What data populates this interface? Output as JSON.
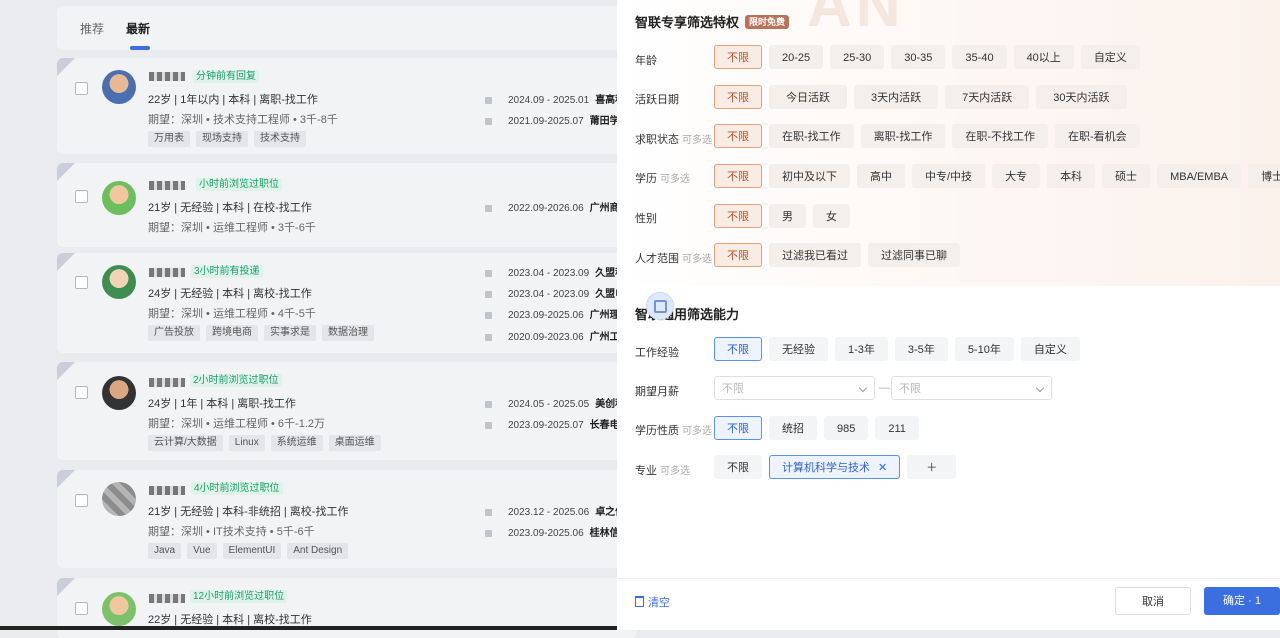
{
  "tabs": {
    "recommend": "推荐",
    "latest": "最新"
  },
  "candidates": [
    {
      "badge": "分钟前有回复",
      "basic": "22岁 | 1年以内 | 本科 | 离职-找工作",
      "expect": "期望：深圳 • 技术支持工程师 • 3千-8千",
      "tags": [
        "万用表",
        "现场支持",
        "技术支持"
      ],
      "edu": [
        {
          "period": "2024.09 - 2025.01",
          "school": "喜高科"
        },
        {
          "period": "2021.09-2025.07",
          "school": "莆田学"
        }
      ]
    },
    {
      "badge": "小时前浏览过职位",
      "basic": "21岁 | 无经验 | 本科 | 在校-找工作",
      "expect": "期望：深圳 • 运维工程师 • 3千-6千",
      "tags": [],
      "edu": [
        {
          "period": "2022.09-2026.06",
          "school": "广州商"
        }
      ]
    },
    {
      "badge": "3小时前有投递",
      "basic": "24岁 | 无经验 | 本科 | 离校-找工作",
      "expect": "期望：深圳 • 运维工程师 • 4千-5千",
      "tags": [
        "广告投放",
        "跨境电商",
        "实事求是",
        "数据治理"
      ],
      "edu": [
        {
          "period": "2023.04 - 2023.09",
          "school": "久盟科"
        },
        {
          "period": "2023.04 - 2023.09",
          "school": "久盟电"
        },
        {
          "period": "2023.09-2025.06",
          "school": "广州理"
        },
        {
          "period": "2020.09-2023.06",
          "school": "广州工"
        }
      ]
    },
    {
      "badge": "2小时前浏览过职位",
      "basic": "24岁 | 1年 | 本科 | 离职-找工作",
      "expect": "期望：深圳 • 运维工程师 • 6千-1.2万",
      "tags": [
        "云计算/大数据",
        "Linux",
        "系统运维",
        "桌面运维"
      ],
      "edu": [
        {
          "period": "2024.05 - 2025.05",
          "school": "美创科"
        },
        {
          "period": "2023.09-2025.07",
          "school": "长春电"
        }
      ]
    },
    {
      "badge": "4小时前浏览过职位",
      "basic": "21岁 | 无经验 | 本科-非统招 | 离校-找工作",
      "expect": "期望：深圳 • IT技术支持 • 5千-6千",
      "tags": [
        "Java",
        "Vue",
        "ElementUI",
        "Ant Design"
      ],
      "edu": [
        {
          "period": "2023.12 - 2025.06",
          "school": "卓之信"
        },
        {
          "period": "2023.09-2025.06",
          "school": "桂林信"
        }
      ]
    },
    {
      "badge": "12小时前浏览过职位",
      "basic": "22岁 | 无经验 | 本科 | 离校-找工作",
      "expect": "",
      "tags": [],
      "edu": []
    }
  ],
  "drawer": {
    "exclusive_title": "智联专享筛选特权",
    "free_badge": "限时免费",
    "multi_hint": "可多选",
    "rows": [
      {
        "label": "年龄",
        "multi": false,
        "options": [
          "不限",
          "20-25",
          "25-30",
          "30-35",
          "35-40",
          "40以上",
          "自定义"
        ]
      },
      {
        "label": "活跃日期",
        "multi": false,
        "options": [
          "不限",
          "今日活跃",
          "3天内活跃",
          "7天内活跃",
          "30天内活跃"
        ]
      },
      {
        "label": "求职状态",
        "multi": true,
        "options": [
          "不限",
          "在职-找工作",
          "离职-找工作",
          "在职-不找工作",
          "在职-看机会"
        ]
      },
      {
        "label": "学历",
        "multi": true,
        "options": [
          "不限",
          "初中及以下",
          "高中",
          "中专/中技",
          "大专",
          "本科",
          "硕士",
          "MBA/EMBA",
          "博士"
        ]
      },
      {
        "label": "性别",
        "multi": false,
        "options": [
          "不限",
          "男",
          "女"
        ]
      },
      {
        "label": "人才范围",
        "multi": true,
        "options": [
          "不限",
          "过滤我已看过",
          "过滤同事已聊"
        ]
      }
    ],
    "general_title": "智联通用筛选能力",
    "work_exp": {
      "label": "工作经验",
      "options": [
        "不限",
        "无经验",
        "1-3年",
        "3-5年",
        "5-10年",
        "自定义"
      ]
    },
    "salary": {
      "label": "期望月薪",
      "min_placeholder": "不限",
      "max_placeholder": "不限",
      "separator": "—"
    },
    "edu_type": {
      "label": "学历性质",
      "options": [
        "不限",
        "统招",
        "985",
        "211"
      ]
    },
    "major": {
      "label": "专业",
      "unlimited": "不限",
      "chip": "计算机科学与技术",
      "chip_remove": "✕",
      "add": "＋"
    },
    "clear_label": "清空",
    "cancel_label": "取消",
    "confirm_label": "确定 · 1"
  },
  "colors": {
    "accent_blue": "#3b6fe0",
    "accent_orange": "#b1552c",
    "badge_green": "#1b9e6b"
  }
}
